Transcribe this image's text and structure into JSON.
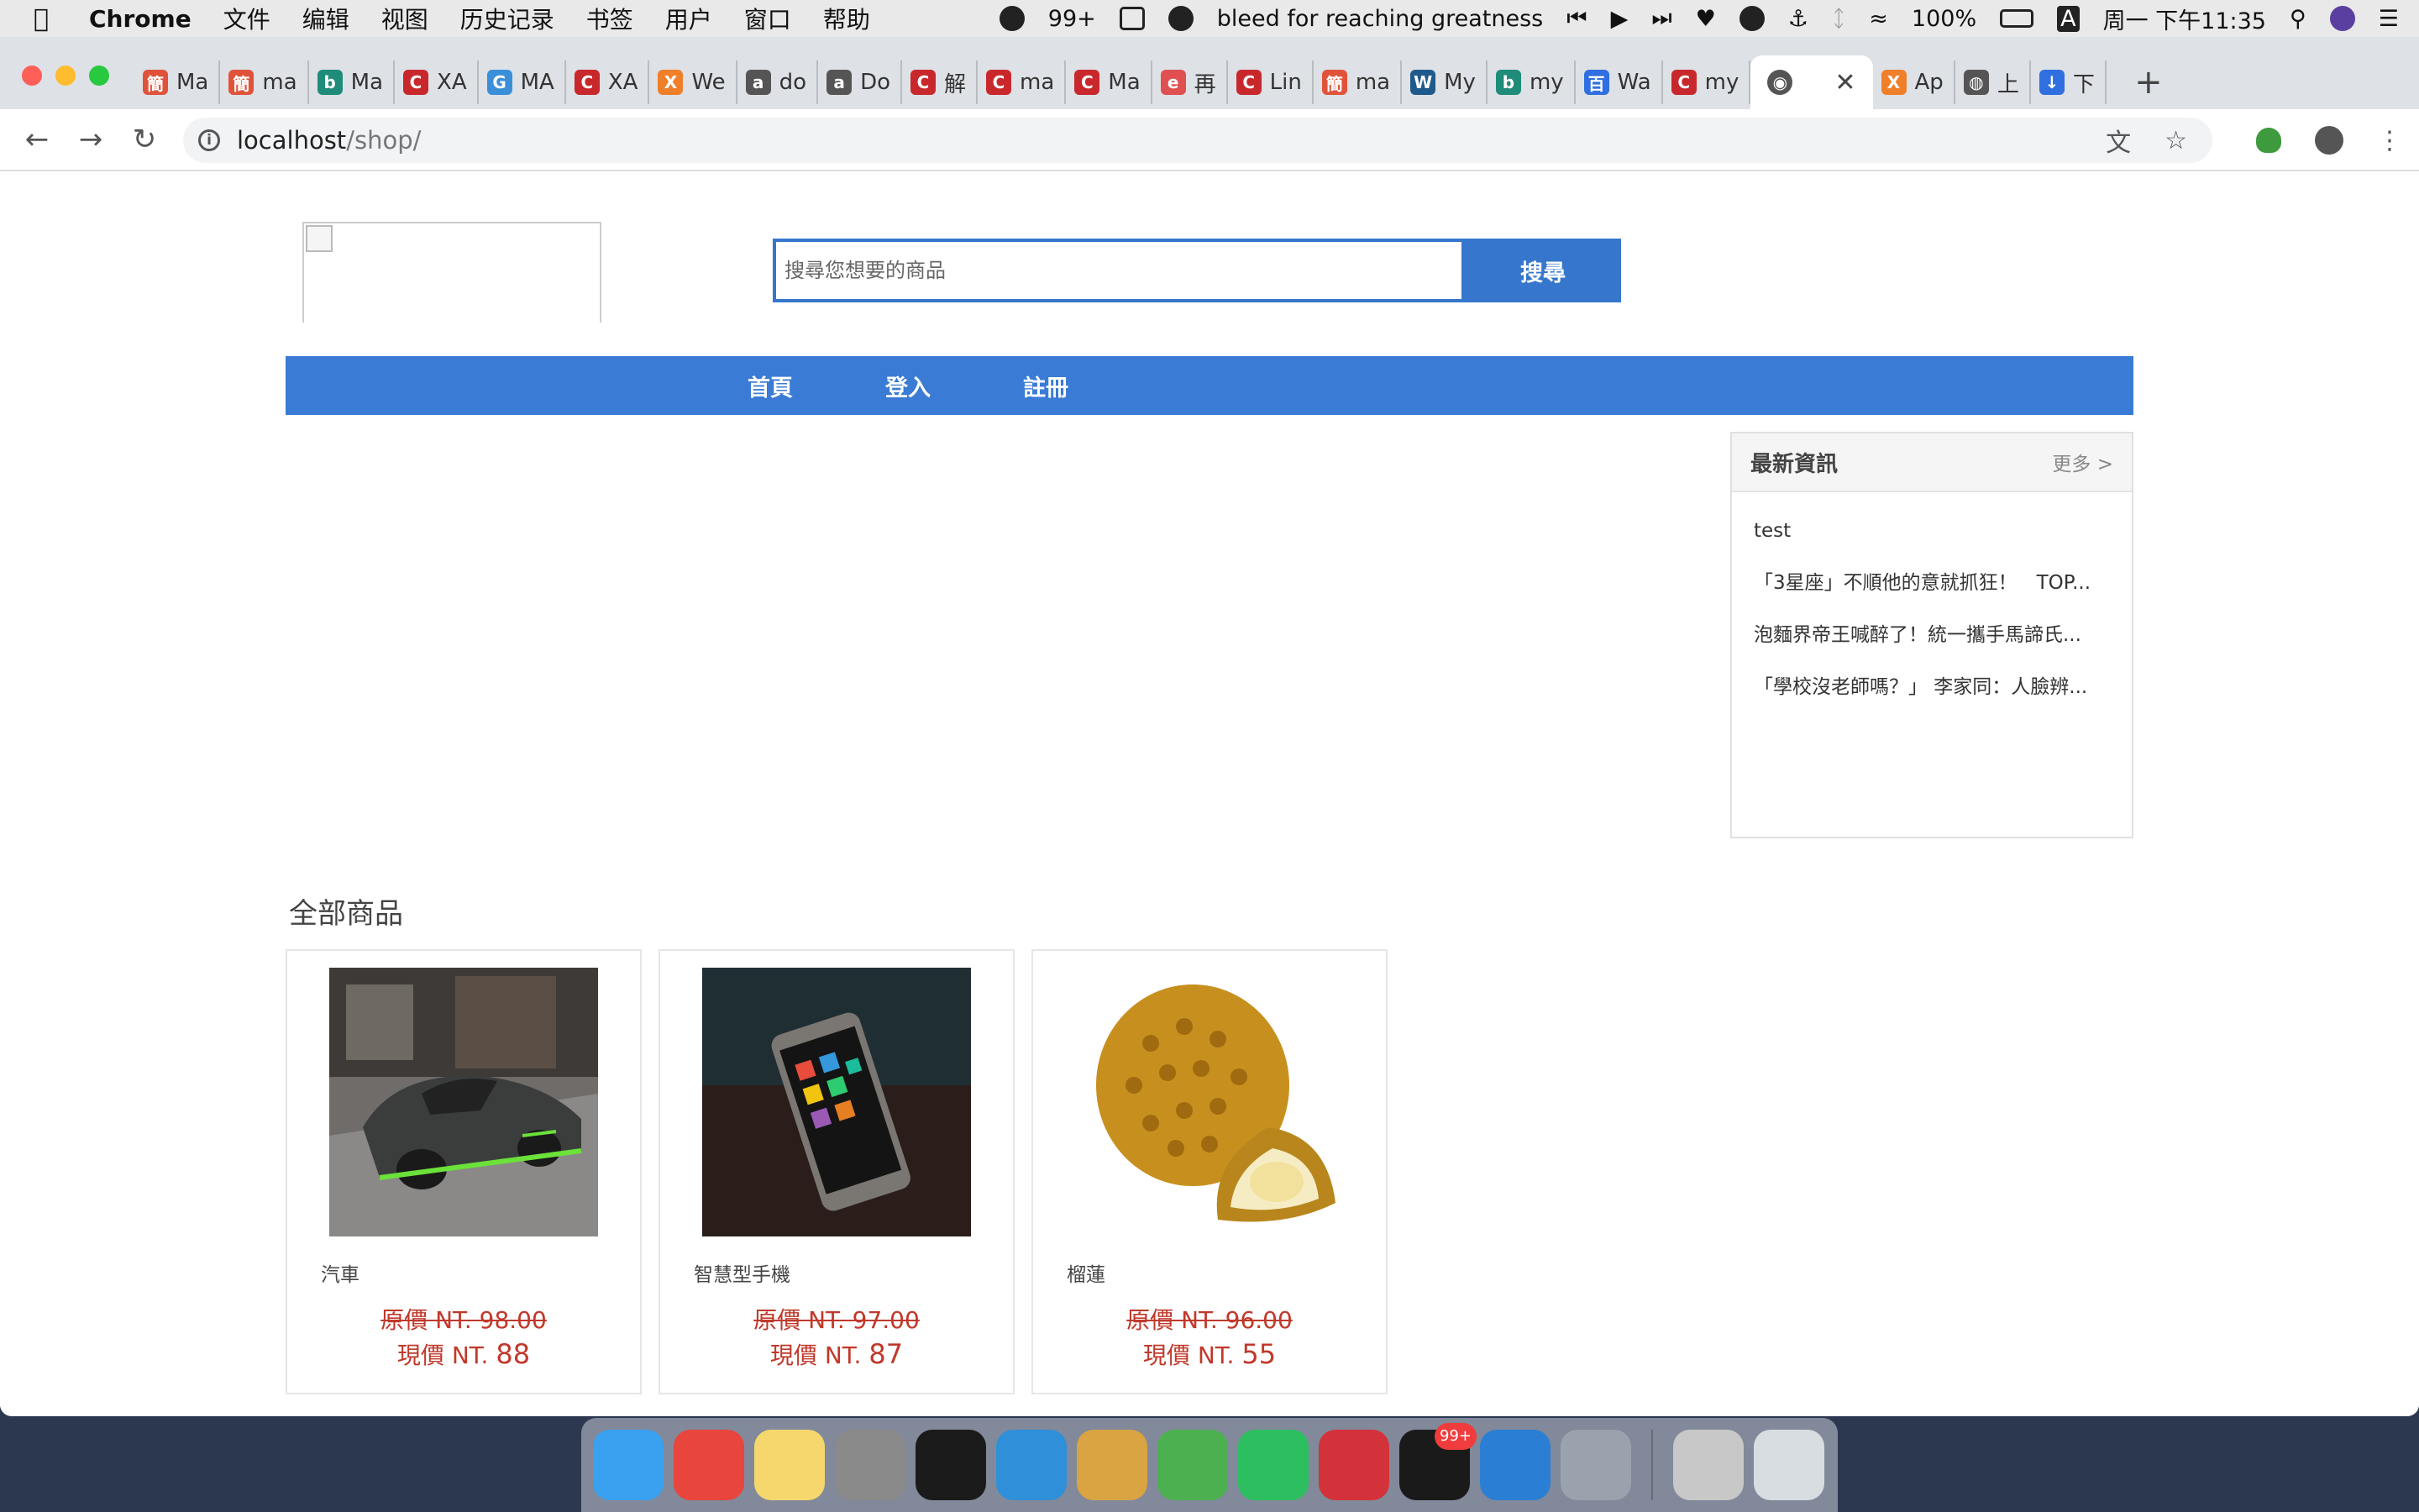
{
  "menubar": {
    "app_name": "Chrome",
    "menus": [
      "文件",
      "编辑",
      "视图",
      "历史记录",
      "书签",
      "用户",
      "窗口",
      "帮助"
    ],
    "qq_badge": "99+",
    "now_playing": "bleed for reaching greatness",
    "battery": "100%",
    "input_method": "A",
    "datetime": "周一 下午11:35"
  },
  "browser": {
    "tabs": [
      {
        "label": "Ma",
        "color": "#e0533a",
        "glyph": "簡"
      },
      {
        "label": "ma",
        "color": "#e0533a",
        "glyph": "簡"
      },
      {
        "label": "Ma",
        "color": "#1f8c7a",
        "glyph": "b"
      },
      {
        "label": "XA",
        "color": "#c8282c",
        "glyph": "C"
      },
      {
        "label": "MA",
        "color": "#3b8fd9",
        "glyph": "G"
      },
      {
        "label": "XA",
        "color": "#c8282c",
        "glyph": "C"
      },
      {
        "label": "We",
        "color": "#f07f2a",
        "glyph": "X"
      },
      {
        "label": "do",
        "color": "#555555",
        "glyph": "a"
      },
      {
        "label": "Do",
        "color": "#555555",
        "glyph": "a"
      },
      {
        "label": "解",
        "color": "#c8282c",
        "glyph": "C"
      },
      {
        "label": "ma",
        "color": "#c8282c",
        "glyph": "C"
      },
      {
        "label": "Ma",
        "color": "#c8282c",
        "glyph": "C"
      },
      {
        "label": "再",
        "color": "#e05050",
        "glyph": "e"
      },
      {
        "label": "Lin",
        "color": "#c8282c",
        "glyph": "C"
      },
      {
        "label": "ma",
        "color": "#e0533a",
        "glyph": "簡"
      },
      {
        "label": "My",
        "color": "#1f5a8c",
        "glyph": "W"
      },
      {
        "label": "my",
        "color": "#1f8c7a",
        "glyph": "b"
      },
      {
        "label": "Wa",
        "color": "#2f6fe0",
        "glyph": "百"
      },
      {
        "label": "my",
        "color": "#c8282c",
        "glyph": "C"
      }
    ],
    "active_tab_close": "✕",
    "tabs_after": [
      {
        "label": "Ap",
        "color": "#f07f2a",
        "glyph": "X"
      },
      {
        "label": "上",
        "color": "#555555",
        "glyph": "◍"
      },
      {
        "label": "下",
        "color": "#2f6fe0",
        "glyph": "↓"
      }
    ],
    "url_host": "localhost",
    "url_path": "/shop/"
  },
  "shop": {
    "search_placeholder": "搜尋您想要的商品",
    "search_button": "搜尋",
    "nav": [
      "首頁",
      "登入",
      "註冊"
    ],
    "news": {
      "title": "最新資訊",
      "more": "更多 >",
      "items": [
        "test",
        "「3星座」不順他的意就抓狂！　TOP...",
        "泡麵界帝王喊醉了！統一攜手馬諦氏...",
        "「學校沒老師嗎？」 李家同：人臉辨..."
      ]
    },
    "section_title": "全部商品",
    "products": [
      {
        "name": "汽車",
        "orig_label": "原價 NT. 98.00",
        "now_prefix": "現價 NT.",
        "now_value": "88"
      },
      {
        "name": "智慧型手機",
        "orig_label": "原價 NT. 97.00",
        "now_prefix": "現價 NT.",
        "now_value": "87"
      },
      {
        "name": "榴蓮",
        "orig_label": "原價 NT. 96.00",
        "now_prefix": "現價 NT.",
        "now_value": "55"
      }
    ]
  },
  "dock": {
    "apps": [
      {
        "name": "finder",
        "color": "#3aa0f0"
      },
      {
        "name": "chrome",
        "color": "#e8453c"
      },
      {
        "name": "notes",
        "color": "#f5d76e"
      },
      {
        "name": "system-preferences",
        "color": "#8a8a8a"
      },
      {
        "name": "terminal",
        "color": "#1b1b1b"
      },
      {
        "name": "search-app",
        "color": "#2f8fd8"
      },
      {
        "name": "sequel-pro",
        "color": "#d9a441"
      },
      {
        "name": "cloud-app",
        "color": "#4cb050"
      },
      {
        "name": "evernote",
        "color": "#2dbe60"
      },
      {
        "name": "netease-music",
        "color": "#d3323a"
      },
      {
        "name": "qq",
        "color": "#1a1a1a",
        "badge": "99+"
      },
      {
        "name": "vscode",
        "color": "#2a7fd4"
      },
      {
        "name": "disk-utility",
        "color": "#9aa3ad"
      }
    ],
    "right_apps": [
      {
        "name": "documents",
        "color": "#c8c8c8"
      },
      {
        "name": "trash",
        "color": "#d8dde2"
      }
    ]
  }
}
